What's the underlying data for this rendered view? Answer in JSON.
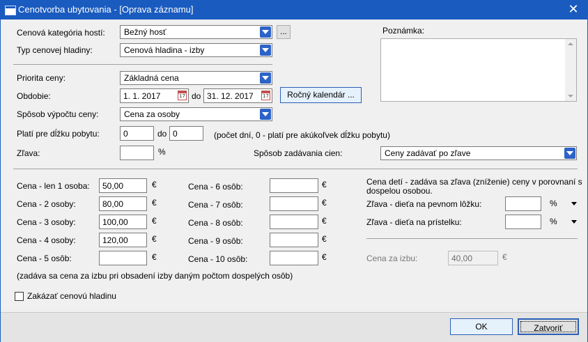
{
  "window": {
    "title": "Cenotvorba ubytovania - [Oprava záznamu]",
    "close_glyph": "✕"
  },
  "form": {
    "guest_category": {
      "label": "Cenová kategória hostí:",
      "value": "Bežný hosť",
      "more_label": "..."
    },
    "price_level_type": {
      "label": "Typ cenovej hladiny:",
      "value": "Cenová hladina - izby"
    },
    "note": {
      "label": "Poznámka:",
      "value": ""
    },
    "priority": {
      "label": "Priorita ceny:",
      "value": "Základná cena"
    },
    "period": {
      "label": "Obdobie:",
      "from": "1. 1. 2017",
      "to_label": "do",
      "to": "31. 12. 2017",
      "calendar_button": "Ročný kalendár ..."
    },
    "calc_method": {
      "label": "Spôsob výpočtu ceny:",
      "value": "Cena za osoby"
    },
    "stay_length": {
      "label": "Platí pre dĺžku pobytu:",
      "from": "0",
      "to_label": "do",
      "to": "0",
      "hint": "(počet dní,  0 - platí pre akúkoľvek dĺžku pobytu)"
    },
    "discount": {
      "label": "Zľava:",
      "value": "",
      "unit": "%"
    },
    "price_entry_method": {
      "label": "Spôsob zadávania cien:",
      "value": "Ceny zadávať po zľave"
    }
  },
  "prices": {
    "currency": "€",
    "left": [
      {
        "label": "Cena - len 1 osoba:",
        "value": "50,00"
      },
      {
        "label": "Cena - 2 osoby:",
        "value": "80,00"
      },
      {
        "label": "Cena - 3 osoby:",
        "value": "100,00"
      },
      {
        "label": "Cena - 4 osoby:",
        "value": "120,00"
      },
      {
        "label": "Cena - 5 osôb:",
        "value": ""
      }
    ],
    "right": [
      {
        "label": "Cena - 6 osôb:",
        "value": ""
      },
      {
        "label": "Cena - 7 osôb:",
        "value": ""
      },
      {
        "label": "Cena - 8 osôb:",
        "value": ""
      },
      {
        "label": "Cena - 9 osôb:",
        "value": ""
      },
      {
        "label": "Cena - 10 osôb:",
        "value": ""
      }
    ],
    "note": "(zadáva sa cena za izbu pri obsadení izby daným počtom dospelých osôb)"
  },
  "children": {
    "description_line1": "Cena detí - zadáva sa zľava (zníženie) ceny v porovnaní s",
    "description_line2": "dospelou osobou.",
    "fixed_bed": {
      "label": "Zľava - dieťa na pevnom lôžku:",
      "value": "",
      "unit": "%"
    },
    "extra_bed": {
      "label": "Zľava - dieťa na prístelku:",
      "value": "",
      "unit": "%"
    },
    "room_price": {
      "label": "Cena za izbu:",
      "value": "40,00",
      "unit": "€"
    }
  },
  "disable_level": {
    "label": "Zakázať cenovú hladinu",
    "checked": false
  },
  "buttons": {
    "ok": "OK",
    "close": "Zatvoriť"
  }
}
